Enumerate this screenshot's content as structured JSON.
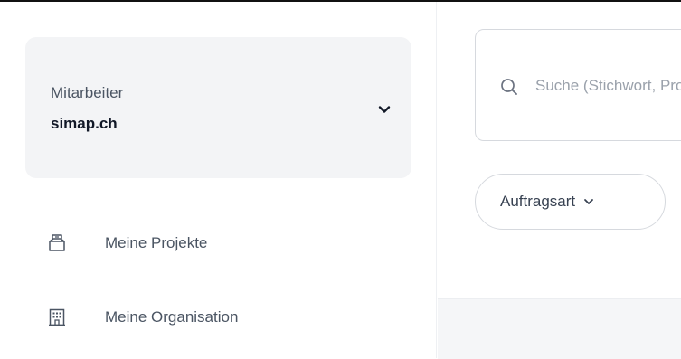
{
  "org_switcher": {
    "label": "Mitarbeiter",
    "name": "simap.ch",
    "icon": "chevron-down-icon"
  },
  "nav": {
    "items": [
      {
        "label": "Meine Projekte",
        "icon": "folder-open-icon"
      },
      {
        "label": "Meine Organisation",
        "icon": "building-icon"
      }
    ]
  },
  "search": {
    "placeholder": "Suche (Stichwort, Projekt-ID, Auftraggeber)",
    "value": "",
    "icon": "search-icon"
  },
  "filters": {
    "auftragsart_label": "Auftragsart",
    "icon": "chevron-down-icon"
  },
  "colors": {
    "sidebar_card_bg": "#f3f4f6",
    "text_primary": "#111827",
    "text_secondary": "#4b5563",
    "placeholder": "#9aa1ab",
    "border": "#d6d9de"
  }
}
